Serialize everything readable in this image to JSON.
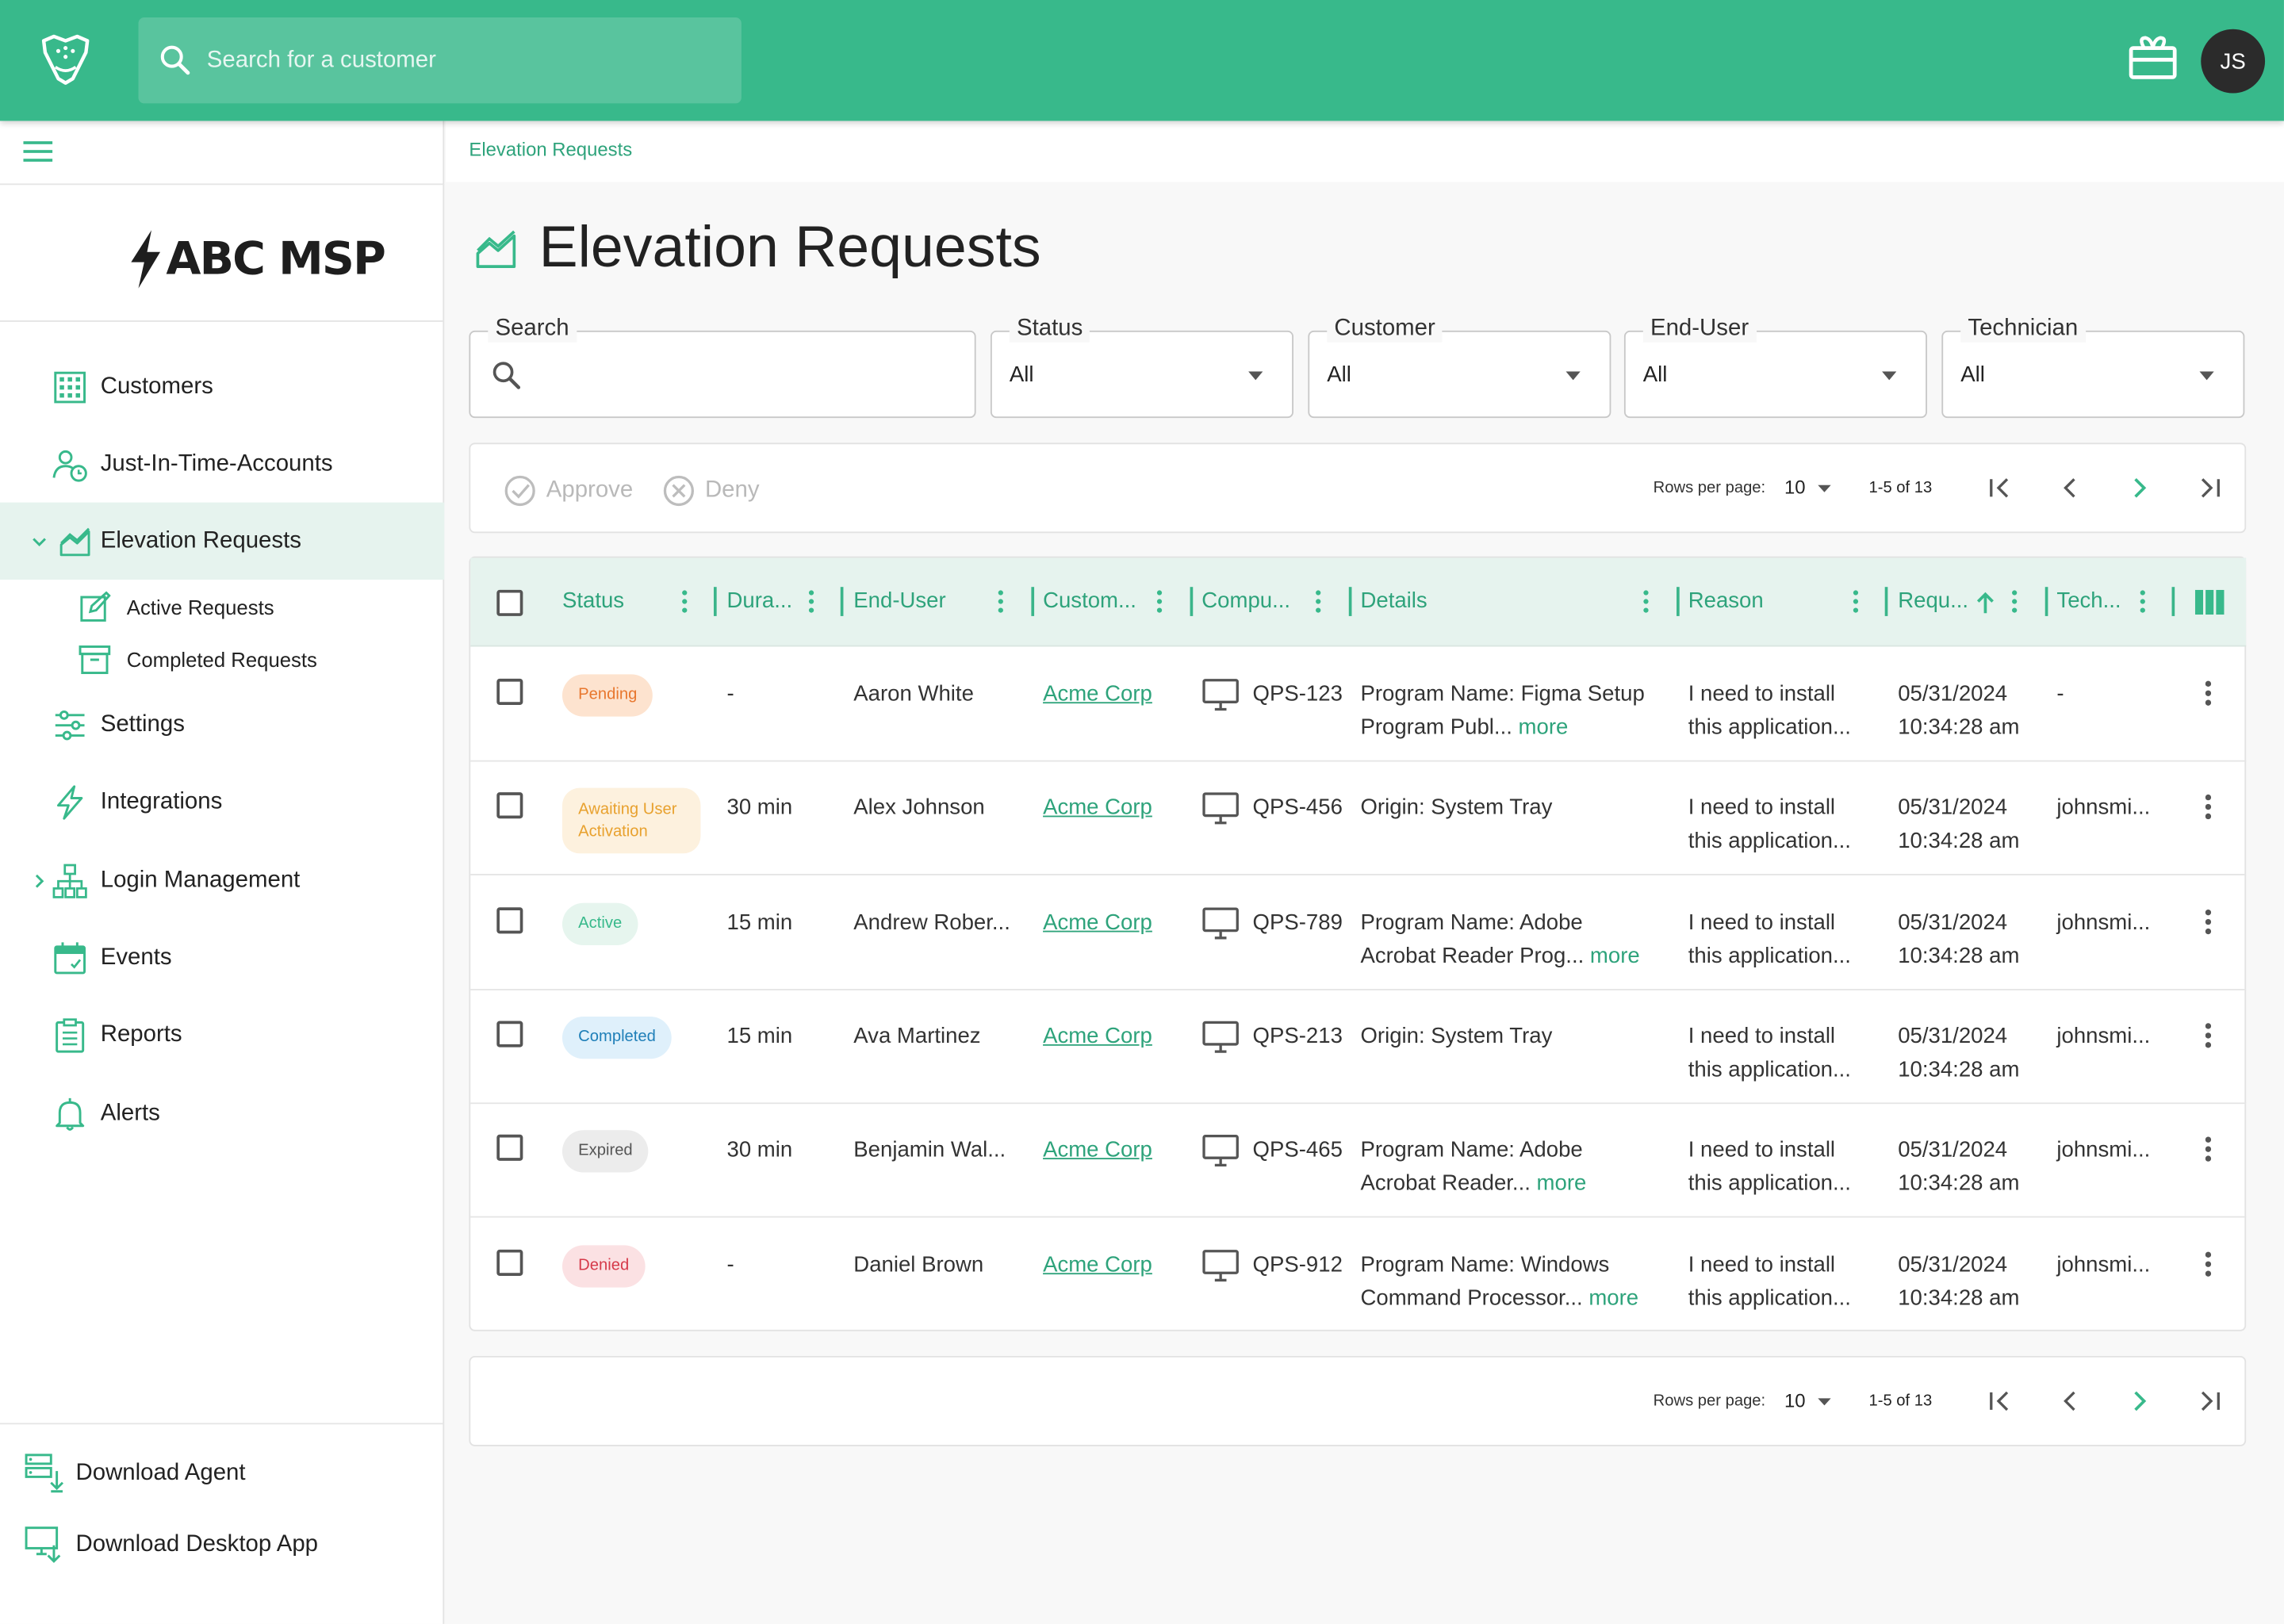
{
  "header": {
    "search_placeholder": "Search for a customer",
    "avatar_initials": "JS",
    "accent": "#38b98b"
  },
  "sidebar": {
    "brand": "ABC MSP",
    "items": [
      {
        "label": "Customers",
        "icon": "building-icon"
      },
      {
        "label": "Just-In-Time-Accounts",
        "icon": "user-clock-icon"
      },
      {
        "label": "Elevation Requests",
        "icon": "chart-area-icon",
        "expanded": true
      },
      {
        "label": "Settings",
        "icon": "sliders-icon"
      },
      {
        "label": "Integrations",
        "icon": "bolt-icon"
      },
      {
        "label": "Login Management",
        "icon": "sitemap-icon"
      },
      {
        "label": "Events",
        "icon": "calendar-icon"
      },
      {
        "label": "Reports",
        "icon": "clipboard-icon"
      },
      {
        "label": "Alerts",
        "icon": "bell-icon"
      }
    ],
    "sub_items": [
      {
        "label": "Active Requests",
        "icon": "edit-icon"
      },
      {
        "label": "Completed Requests",
        "icon": "archive-icon"
      }
    ],
    "downloads": [
      {
        "label": "Download Agent",
        "icon": "server-download-icon"
      },
      {
        "label": "Download Desktop App",
        "icon": "monitor-download-icon"
      }
    ]
  },
  "page": {
    "breadcrumb": "Elevation Requests",
    "title": "Elevation Requests"
  },
  "filters": {
    "search_label": "Search",
    "status_label": "Status",
    "status_value": "All",
    "customer_label": "Customer",
    "customer_value": "All",
    "enduser_label": "End-User",
    "enduser_value": "All",
    "technician_label": "Technician",
    "technician_value": "All"
  },
  "toolbar": {
    "approve": "Approve",
    "deny": "Deny",
    "rows_per_page_label": "Rows per page:",
    "rows_per_page": "10",
    "range": "1-5 of 13"
  },
  "table": {
    "columns": [
      "Status",
      "Dura...",
      "End-User",
      "Custom...",
      "Compu...",
      "Details",
      "Reason",
      "Requ...",
      "Tech..."
    ],
    "rows": [
      {
        "status": "Pending",
        "duration": "-",
        "end_user": "Aaron White",
        "customer": "Acme Corp",
        "computer": "QPS-123",
        "details_1": "Program Name: Figma Setup",
        "details_2": "Program Publ...",
        "details_more": "more",
        "reason_1": "I need to install",
        "reason_2": "this application...",
        "date": "05/31/2024",
        "time": "10:34:28 am",
        "tech": "-"
      },
      {
        "status": "Awaiting User Activation",
        "duration": "30 min",
        "end_user": "Alex Johnson",
        "customer": "Acme Corp",
        "computer": "QPS-456",
        "details_1": "Origin: System Tray",
        "details_2": "",
        "details_more": "",
        "reason_1": "I need to install",
        "reason_2": "this application...",
        "date": "05/31/2024",
        "time": "10:34:28 am",
        "tech": "johnsmi..."
      },
      {
        "status": "Active",
        "duration": "15 min",
        "end_user": "Andrew Rober...",
        "customer": "Acme Corp",
        "computer": "QPS-789",
        "details_1": "Program Name: Adobe",
        "details_2": "Acrobat Reader Prog...",
        "details_more": "more",
        "reason_1": "I need to install",
        "reason_2": "this application...",
        "date": "05/31/2024",
        "time": "10:34:28 am",
        "tech": "johnsmi..."
      },
      {
        "status": "Completed",
        "duration": "15 min",
        "end_user": "Ava Martinez",
        "customer": "Acme Corp",
        "computer": "QPS-213",
        "details_1": "Origin: System Tray",
        "details_2": "",
        "details_more": "",
        "reason_1": "I need to install",
        "reason_2": "this application...",
        "date": "05/31/2024",
        "time": "10:34:28 am",
        "tech": "johnsmi..."
      },
      {
        "status": "Expired",
        "duration": "30 min",
        "end_user": "Benjamin Wal...",
        "customer": "Acme Corp",
        "computer": "QPS-465",
        "details_1": "Program Name: Adobe",
        "details_2": "Acrobat Reader...",
        "details_more": "more",
        "reason_1": "I need to install",
        "reason_2": "this application...",
        "date": "05/31/2024",
        "time": "10:34:28 am",
        "tech": "johnsmi..."
      },
      {
        "status": "Denied",
        "duration": "-",
        "end_user": "Daniel Brown",
        "customer": "Acme Corp",
        "computer": "QPS-912",
        "details_1": "Program Name: Windows",
        "details_2": "Command Processor...",
        "details_more": "more",
        "reason_1": "I need to install",
        "reason_2": "this application...",
        "date": "05/31/2024",
        "time": "10:34:28 am",
        "tech": "johnsmi..."
      }
    ]
  },
  "status_colors": {
    "Pending": {
      "bg": "#fde3cf",
      "fg": "#e8772e"
    },
    "Awaiting User Activation": {
      "bg": "#fdf1de",
      "fg": "#e8a12e"
    },
    "Active": {
      "bg": "#e6f5ee",
      "fg": "#38b98b"
    },
    "Completed": {
      "bg": "#dff0fb",
      "fg": "#1f7fb8"
    },
    "Expired": {
      "bg": "#ececec",
      "fg": "#555555"
    },
    "Denied": {
      "bg": "#fbe1e3",
      "fg": "#d63a4a"
    }
  }
}
